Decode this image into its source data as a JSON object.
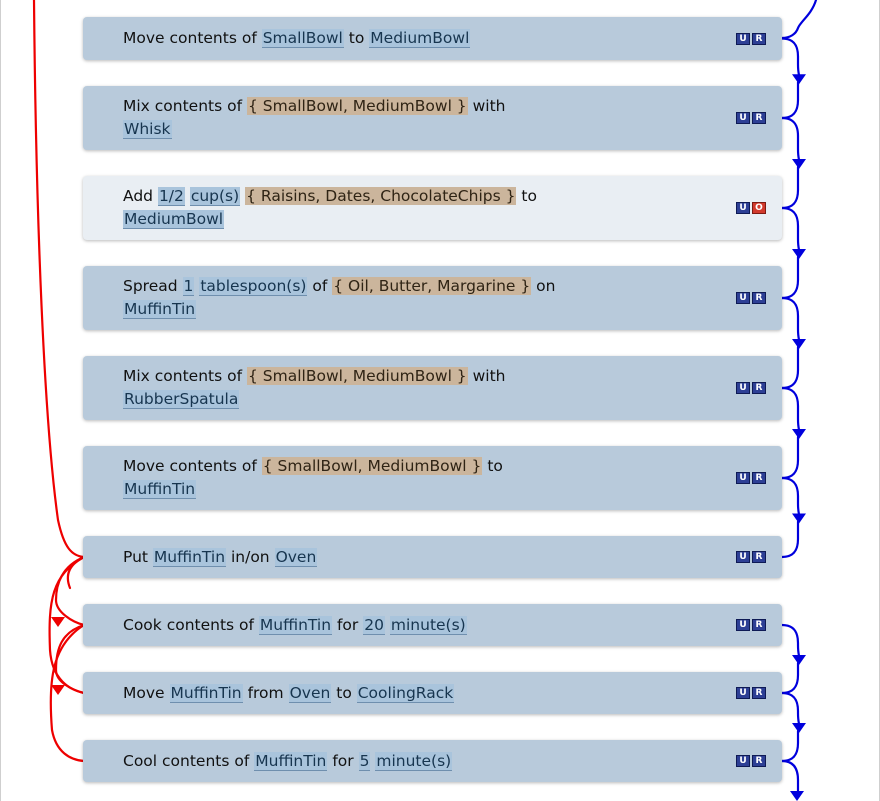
{
  "steps": [
    {
      "parts": [
        {
          "t": "text",
          "v": "Move contents of "
        },
        {
          "t": "ing",
          "v": "SmallBowl"
        },
        {
          "t": "text",
          "v": " to "
        },
        {
          "t": "ing",
          "v": "MediumBowl"
        }
      ],
      "buttons": [
        "U",
        "R"
      ]
    },
    {
      "parts": [
        {
          "t": "text",
          "v": "Mix contents of "
        },
        {
          "t": "grp",
          "v": "{ SmallBowl, MediumBowl }"
        },
        {
          "t": "text",
          "v": " with "
        },
        {
          "t": "br"
        },
        {
          "t": "ing",
          "v": "Whisk"
        }
      ],
      "buttons": [
        "U",
        "R"
      ]
    },
    {
      "active": true,
      "parts": [
        {
          "t": "text",
          "v": "Add "
        },
        {
          "t": "ing",
          "v": "1/2"
        },
        {
          "t": "text",
          "v": " "
        },
        {
          "t": "ing",
          "v": "cup(s)"
        },
        {
          "t": "text",
          "v": " "
        },
        {
          "t": "grp",
          "v": "{ Raisins, Dates, ChocolateChips }"
        },
        {
          "t": "text",
          "v": " to "
        },
        {
          "t": "br"
        },
        {
          "t": "ing",
          "v": "MediumBowl"
        }
      ],
      "buttons": [
        "U",
        "O"
      ]
    },
    {
      "parts": [
        {
          "t": "text",
          "v": "Spread "
        },
        {
          "t": "ing",
          "v": "1"
        },
        {
          "t": "text",
          "v": " "
        },
        {
          "t": "ing",
          "v": "tablespoon(s)"
        },
        {
          "t": "text",
          "v": " of "
        },
        {
          "t": "grp",
          "v": "{ Oil, Butter, Margarine }"
        },
        {
          "t": "text",
          "v": " on "
        },
        {
          "t": "br"
        },
        {
          "t": "ing",
          "v": "MuffinTin"
        }
      ],
      "buttons": [
        "U",
        "R"
      ]
    },
    {
      "parts": [
        {
          "t": "text",
          "v": "Mix contents of "
        },
        {
          "t": "grp",
          "v": "{ SmallBowl, MediumBowl }"
        },
        {
          "t": "text",
          "v": " with "
        },
        {
          "t": "br"
        },
        {
          "t": "ing",
          "v": "RubberSpatula"
        }
      ],
      "buttons": [
        "U",
        "R"
      ]
    },
    {
      "parts": [
        {
          "t": "text",
          "v": "Move contents of "
        },
        {
          "t": "grp",
          "v": "{ SmallBowl, MediumBowl }"
        },
        {
          "t": "text",
          "v": " to "
        },
        {
          "t": "br"
        },
        {
          "t": "ing",
          "v": "MuffinTin"
        }
      ],
      "buttons": [
        "U",
        "R"
      ]
    },
    {
      "parts": [
        {
          "t": "text",
          "v": "Put "
        },
        {
          "t": "ing",
          "v": "MuffinTin"
        },
        {
          "t": "text",
          "v": " in/on "
        },
        {
          "t": "ing",
          "v": "Oven"
        }
      ],
      "buttons": [
        "U",
        "R"
      ]
    },
    {
      "parts": [
        {
          "t": "text",
          "v": "Cook contents of "
        },
        {
          "t": "ing",
          "v": "MuffinTin"
        },
        {
          "t": "text",
          "v": " for "
        },
        {
          "t": "ing",
          "v": "20"
        },
        {
          "t": "text",
          "v": " "
        },
        {
          "t": "ing",
          "v": "minute(s)"
        }
      ],
      "buttons": [
        "U",
        "R"
      ]
    },
    {
      "parts": [
        {
          "t": "text",
          "v": "Move "
        },
        {
          "t": "ing",
          "v": "MuffinTin"
        },
        {
          "t": "text",
          "v": " from "
        },
        {
          "t": "ing",
          "v": "Oven"
        },
        {
          "t": "text",
          "v": " to "
        },
        {
          "t": "ing",
          "v": "CoolingRack"
        }
      ],
      "buttons": [
        "U",
        "R"
      ]
    },
    {
      "parts": [
        {
          "t": "text",
          "v": "Cool contents of "
        },
        {
          "t": "ing",
          "v": "MuffinTin"
        },
        {
          "t": "text",
          "v": " for "
        },
        {
          "t": "ing",
          "v": "5"
        },
        {
          "t": "text",
          "v": " "
        },
        {
          "t": "ing",
          "v": "minute(s)"
        }
      ],
      "buttons": [
        "U",
        "R"
      ]
    }
  ],
  "colors": {
    "card": "#b8cadb",
    "card_active": "#e9eef3",
    "ingredient_highlight": "#a9c4dc",
    "group_highlight": "#cbb59c",
    "sequence_connector": "#0000dd",
    "dependency_connector": "#ee0000",
    "button_blue": "#2d3f95",
    "button_red": "#d23a2c"
  }
}
